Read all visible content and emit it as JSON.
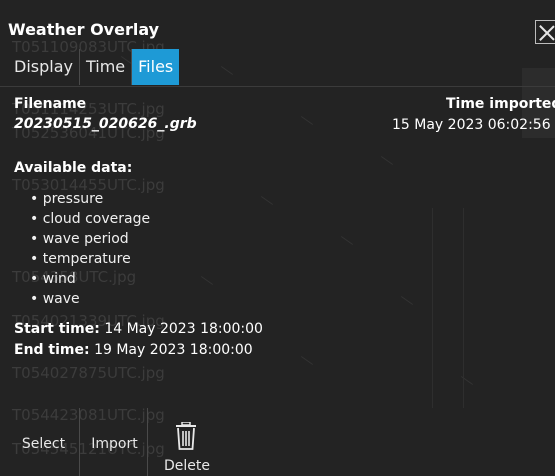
{
  "window": {
    "title": "Weather Overlay",
    "close_icon": "close-icon"
  },
  "tabs": [
    {
      "label": "Display",
      "active": false
    },
    {
      "label": "Time",
      "active": false
    },
    {
      "label": "Files",
      "active": true
    }
  ],
  "file": {
    "filename_label": "Filename",
    "filename": "20230515_020626_.grb",
    "time_imported_label": "Time imported",
    "time_imported": "15 May 2023 06:02:56"
  },
  "available": {
    "label": "Available data:",
    "items": [
      "pressure",
      "cloud coverage",
      "wave period",
      "temperature",
      "wind",
      "wave"
    ]
  },
  "times": {
    "start_label": "Start time:",
    "start_value": "14 May 2023 18:00:00",
    "end_label": "End time:",
    "end_value": "19 May 2023 18:00:00"
  },
  "background_files": [
    "T051109083UTC.jpg",
    "T051114253UTC.jpg",
    "T052536041UTC.jpg",
    "T053014455UTC.jpg",
    "T054358UTC.jpg",
    "T054021339UTC.jpg",
    "T054027875UTC.jpg",
    "T054423081UTC.jpg",
    "T054545121UTC.jpg"
  ],
  "toolbar": {
    "select_label": "Select",
    "import_label": "Import",
    "delete_label": "Delete",
    "delete_icon": "trash-icon"
  },
  "colors": {
    "background": "#232323",
    "tab_active": "#1e9ad6",
    "text": "#ffffff"
  }
}
